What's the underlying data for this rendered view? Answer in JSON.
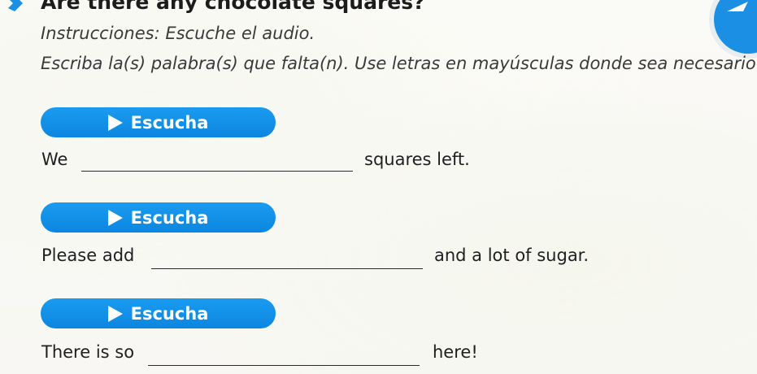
{
  "question": {
    "title": "Are there any chocolate squares?"
  },
  "instructions": {
    "line1": "Instrucciones: Escuche el audio.",
    "line2": "Escriba la(s) palabra(s) que falta(n). Use letras en mayúsculas donde sea necesario."
  },
  "items": [
    {
      "listen_label": "Escucha",
      "before": "We",
      "blank_value": "",
      "after": "squares left."
    },
    {
      "listen_label": "Escucha",
      "before": "Please add",
      "blank_value": "",
      "after": "and a lot of sugar."
    },
    {
      "listen_label": "Escucha",
      "before": "There is so",
      "blank_value": "",
      "after": "here!"
    }
  ],
  "colors": {
    "accent": "#1a8fe3",
    "button": "#0c86e0"
  },
  "icons": {
    "header": "chevron-right-icon",
    "corner": "next-arrow-icon",
    "play": "play-icon"
  }
}
